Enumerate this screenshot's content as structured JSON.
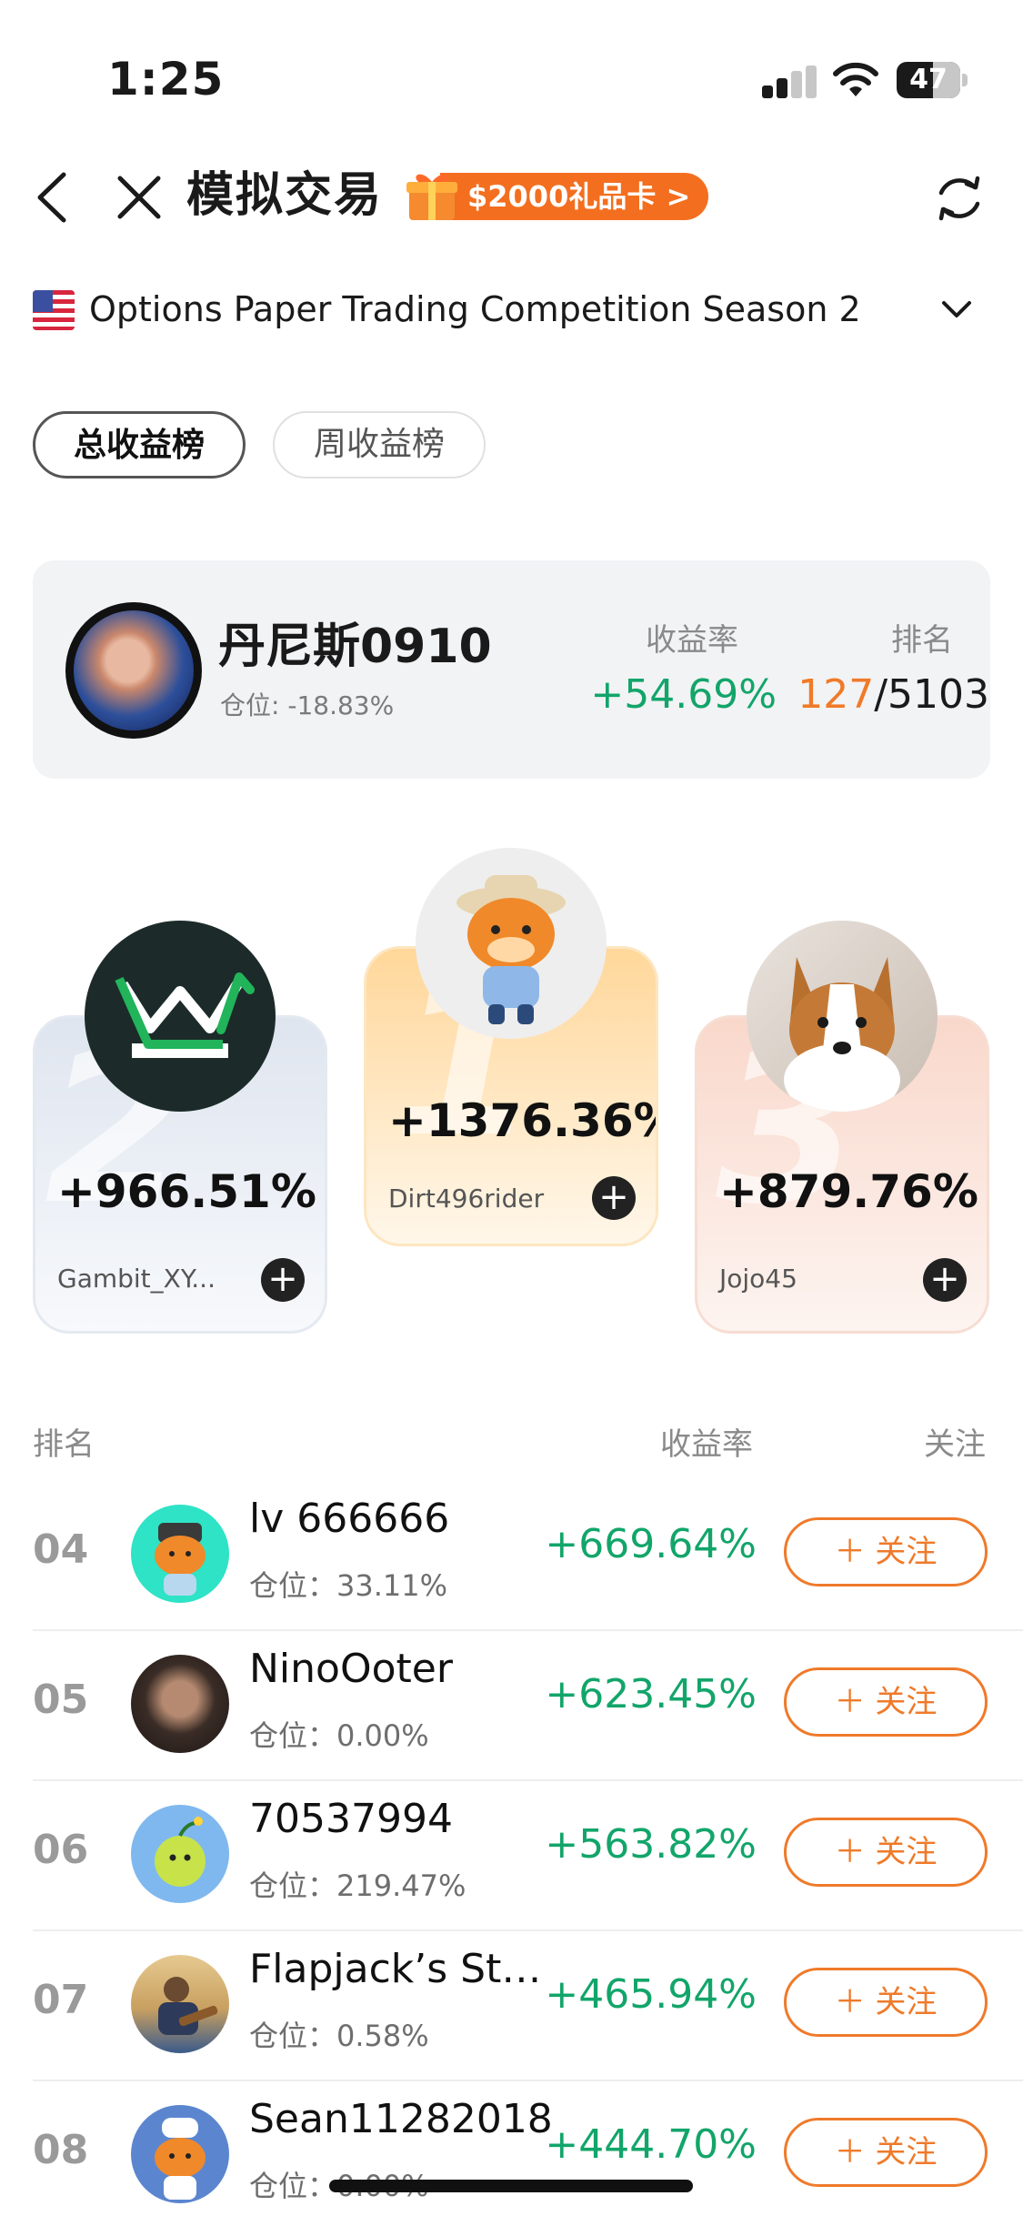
{
  "status_bar": {
    "time": "1:25",
    "battery": "47"
  },
  "nav": {
    "title": "模拟交易",
    "gift_badge": "$2000礼品卡 >"
  },
  "competition": {
    "name": "Options Paper Trading Competition Season 2"
  },
  "tabs": [
    {
      "label": "总收益榜",
      "active": true
    },
    {
      "label": "周收益榜",
      "active": false
    }
  ],
  "my_card": {
    "name": "丹尼斯0910",
    "position": "仓位: -18.83%",
    "rate_label": "收益率",
    "rate": "+54.69%",
    "rank_label": "排名",
    "rank_current": "127",
    "rank_total": "/5103"
  },
  "podium": [
    {
      "rank": "2",
      "value": "+966.51%",
      "name": "Gambit_XY...",
      "follow": "+"
    },
    {
      "rank": "1",
      "value": "+1376.36%",
      "name": "Dirt496rider",
      "follow": "+"
    },
    {
      "rank": "3",
      "value": "+879.76%",
      "name": "Jojo45",
      "follow": "+"
    }
  ],
  "list_header": {
    "rank": "排名",
    "rate": "收益率",
    "follow": "关注"
  },
  "rows": [
    {
      "rank": "04",
      "name": "lv 666666",
      "position": "仓位：33.11%",
      "rate": "+669.64%",
      "follow": "＋ 关注"
    },
    {
      "rank": "05",
      "name": "NinoOoter",
      "position": "仓位：0.00%",
      "rate": "+623.45%",
      "follow": "＋ 关注"
    },
    {
      "rank": "06",
      "name": "70537994",
      "position": "仓位：219.47%",
      "rate": "+563.82%",
      "follow": "＋ 关注"
    },
    {
      "rank": "07",
      "name": "Flapjack’s Sta...",
      "position": "仓位：0.58%",
      "rate": "+465.94%",
      "follow": "＋ 关注"
    },
    {
      "rank": "08",
      "name": "Sean11282018",
      "position": "仓位：0.00%",
      "rate": "+444.70%",
      "follow": "＋ 关注"
    }
  ],
  "colors": {
    "accent_orange": "#ef7a2a",
    "gain_green": "#12a56a"
  }
}
